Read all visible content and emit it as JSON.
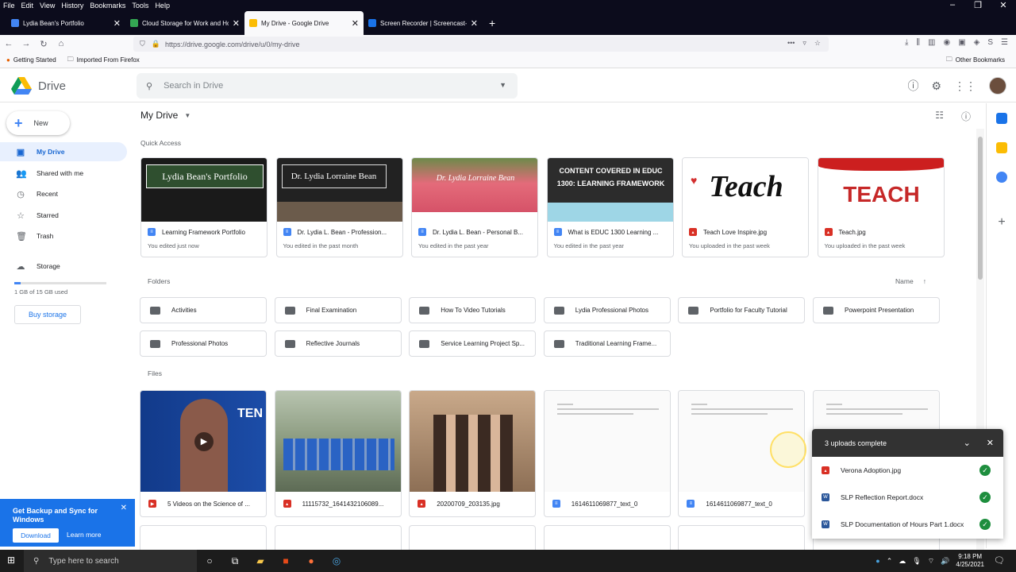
{
  "menubar": [
    "File",
    "Edit",
    "View",
    "History",
    "Bookmarks",
    "Tools",
    "Help"
  ],
  "tabs": [
    {
      "label": "Lydia Bean's Portfolio",
      "color": "#4285f4"
    },
    {
      "label": "Cloud Storage for Work and Ho",
      "color": "#34a853"
    },
    {
      "label": "My Drive - Google Drive",
      "color": "#fbbc04"
    },
    {
      "label": "Screen Recorder | Screencast-O",
      "color": "#1a73e8"
    }
  ],
  "url": "https://drive.google.com/drive/u/0/my-drive",
  "bookmarks": [
    "Getting Started",
    "Imported From Firefox"
  ],
  "other_bookmarks": "Other Bookmarks",
  "app": {
    "name": "Drive",
    "search_placeholder": "Search in Drive"
  },
  "sidebar": {
    "new_label": "New",
    "items": [
      {
        "label": "My Drive",
        "icon": "drive-icon"
      },
      {
        "label": "Shared with me",
        "icon": "people-icon"
      },
      {
        "label": "Recent",
        "icon": "clock-icon"
      },
      {
        "label": "Starred",
        "icon": "star-icon"
      },
      {
        "label": "Trash",
        "icon": "trash-icon"
      },
      {
        "label": "Storage",
        "icon": "cloud-icon"
      }
    ],
    "storage_fraction": 0.067,
    "storage_used": "1 GB of 15 GB used",
    "buy_storage": "Buy storage"
  },
  "main": {
    "title": "My Drive",
    "quick_access_label": "Quick Access",
    "quick_access": [
      {
        "name": "Learning Framework Portfolio",
        "sub": "You edited just now",
        "type": "doc",
        "thumb_text": "Lydia Bean's Portfolio"
      },
      {
        "name": "Dr. Lydia L. Bean - Profession...",
        "sub": "You edited in the past month",
        "type": "doc",
        "thumb_text": "Dr. Lydia Lorraine Bean"
      },
      {
        "name": "Dr. Lydia L. Bean - Personal B...",
        "sub": "You edited in the past year",
        "type": "doc",
        "thumb_text": "Dr. Lydia Lorraine Bean"
      },
      {
        "name": "What is EDUC 1300 Learning ...",
        "sub": "You edited in the past year",
        "type": "doc",
        "thumb_text": "CONTENT COVERED IN EDUC 1300: LEARNING FRAMEWORK"
      },
      {
        "name": "Teach Love Inspire.jpg",
        "sub": "You uploaded in the past week",
        "type": "img",
        "thumb_text": "Teach"
      },
      {
        "name": "Teach.jpg",
        "sub": "You uploaded in the past week",
        "type": "img",
        "thumb_text": "TEACH"
      }
    ],
    "folders_label": "Folders",
    "sort_label": "Name",
    "folders": [
      "Activities",
      "Final Examination",
      "How To Video Tutorials",
      "Lydia Professional Photos",
      "Portfolio for Faculty Tutorial",
      "Powerpoint Presentation",
      "Professional Photos",
      "Reflective Journals",
      "Service Learning Project Sp...",
      "Traditional Learning Frame..."
    ],
    "files_label": "Files",
    "files": [
      {
        "name": "5 Videos on the Science of ...",
        "type": "video"
      },
      {
        "name": "11115732_1641432106089...",
        "type": "img"
      },
      {
        "name": "20200709_203135.jpg",
        "type": "img"
      },
      {
        "name": "1614611069877_text_0",
        "type": "doc"
      },
      {
        "name": "1614611069877_text_0",
        "type": "doc"
      },
      {
        "name": "",
        "type": "doc"
      }
    ]
  },
  "video_thumb_text": "TEN",
  "upload": {
    "title": "3 uploads complete",
    "items": [
      {
        "name": "Verona Adoption.jpg",
        "type": "img"
      },
      {
        "name": "SLP Reflection Report.docx",
        "type": "word"
      },
      {
        "name": "SLP Documentation of Hours Part 1.docx",
        "type": "word"
      }
    ]
  },
  "backup": {
    "title": "Get Backup and Sync for Windows",
    "download": "Download",
    "learn_more": "Learn more"
  },
  "taskbar": {
    "search": "Type here to search",
    "time": "9:18 PM",
    "date": "4/25/2021"
  }
}
